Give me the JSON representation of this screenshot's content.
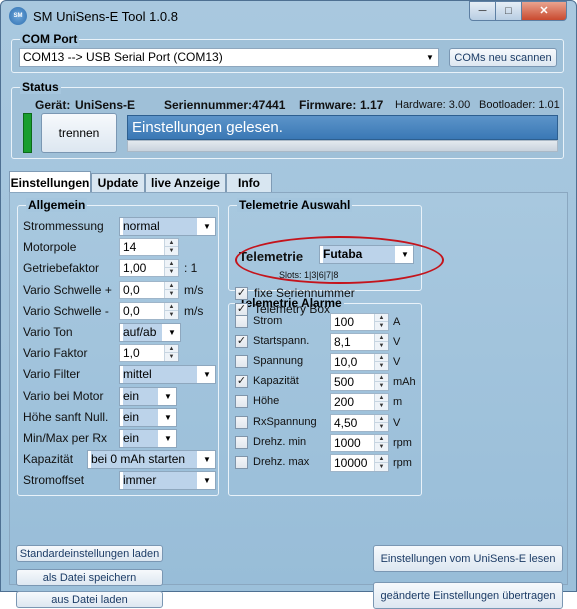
{
  "window": {
    "title": "SM UniSens-E Tool 1.0.8",
    "icon_text": "SM",
    "controls": {
      "minimize": "─",
      "maximize": "□",
      "close": "✕"
    }
  },
  "com_port": {
    "legend": "COM Port",
    "selected": "COM13 --> USB Serial Port (COM13)",
    "scan_button": "COMs neu scannen"
  },
  "status": {
    "legend": "Status",
    "device_label": "Gerät:",
    "device_value": "UniSens-E",
    "serial_label": "Seriennummer:",
    "serial_value": "47441",
    "firmware_label": "Firmware:",
    "firmware_value": "1.17",
    "hardware": "Hardware: 3.00",
    "bootloader": "Bootloader: 1.01",
    "disconnect_button": "trennen",
    "message": "Einstellungen gelesen.",
    "indicator_color": "#189e2e"
  },
  "tabs": [
    "Einstellungen",
    "Update",
    "live Anzeige",
    "Info"
  ],
  "allgemein": {
    "legend": "Allgemein",
    "rows": [
      {
        "label": "Strommessung",
        "value": "normal",
        "kind": "combo"
      },
      {
        "label": "Motorpole",
        "value": "14",
        "kind": "spin"
      },
      {
        "label": "Getriebefaktor",
        "value": "1,00",
        "kind": "spin",
        "unit": ": 1"
      },
      {
        "label": "Vario Schwelle +",
        "value": "0,0",
        "kind": "spin",
        "unit": "m/s"
      },
      {
        "label": "Vario Schwelle -",
        "value": "0,0",
        "kind": "spin",
        "unit": "m/s"
      },
      {
        "label": "Vario Ton",
        "value": "auf/ab",
        "kind": "combo"
      },
      {
        "label": "Vario Faktor",
        "value": "1,0",
        "kind": "spin"
      },
      {
        "label": "Vario Filter",
        "value": "mittel",
        "kind": "combo"
      },
      {
        "label": "Vario bei Motor",
        "value": "ein",
        "kind": "combo"
      },
      {
        "label": "Höhe sanft Null.",
        "value": "ein",
        "kind": "combo"
      },
      {
        "label": "Min/Max per Rx",
        "value": "ein",
        "kind": "combo"
      },
      {
        "label": "Kapazität",
        "value": "bei 0 mAh starten",
        "kind": "combo"
      },
      {
        "label": "Stromoffset",
        "value": "immer",
        "kind": "combo"
      }
    ]
  },
  "telemetrie_auswahl": {
    "legend": "Telemetrie Auswahl",
    "label": "Telemetrie",
    "selected": "Futaba",
    "slots": "Slots: 1|3|6|7|8",
    "fixe_seriennummer": {
      "label": "fixe Seriennummer",
      "checked": true
    },
    "telemetry_box": {
      "label": "Telemetry Box",
      "checked": true
    }
  },
  "telemetrie_alarme": {
    "legend": "Telemetrie Alarme",
    "rows": [
      {
        "label": "Strom",
        "checked": false,
        "value": "100",
        "unit": "A"
      },
      {
        "label": "Startspann.",
        "checked": true,
        "value": "8,1",
        "unit": "V"
      },
      {
        "label": "Spannung",
        "checked": false,
        "value": "10,0",
        "unit": "V"
      },
      {
        "label": "Kapazität",
        "checked": true,
        "value": "500",
        "unit": "mAh"
      },
      {
        "label": "Höhe",
        "checked": false,
        "value": "200",
        "unit": "m"
      },
      {
        "label": "RxSpannung",
        "checked": false,
        "value": "4,50",
        "unit": "V"
      },
      {
        "label": "Drehz. min",
        "checked": false,
        "value": "1000",
        "unit": "rpm"
      },
      {
        "label": "Drehz. max",
        "checked": false,
        "value": "10000",
        "unit": "rpm"
      }
    ]
  },
  "buttons": {
    "defaults": "Standardeinstellungen laden",
    "save_file": "als Datei speichern",
    "load_file": "aus Datei laden",
    "read_settings": "Einstellungen vom UniSens-E lesen",
    "write_settings": "geänderte Einstellungen übertragen"
  },
  "icons": {
    "dropdown": "▼",
    "spin_up": "▲",
    "spin_down": "▼",
    "check": "✓"
  },
  "colors": {
    "highlight_ellipse": "#c4141c",
    "status_bar": "#4a88c2"
  }
}
